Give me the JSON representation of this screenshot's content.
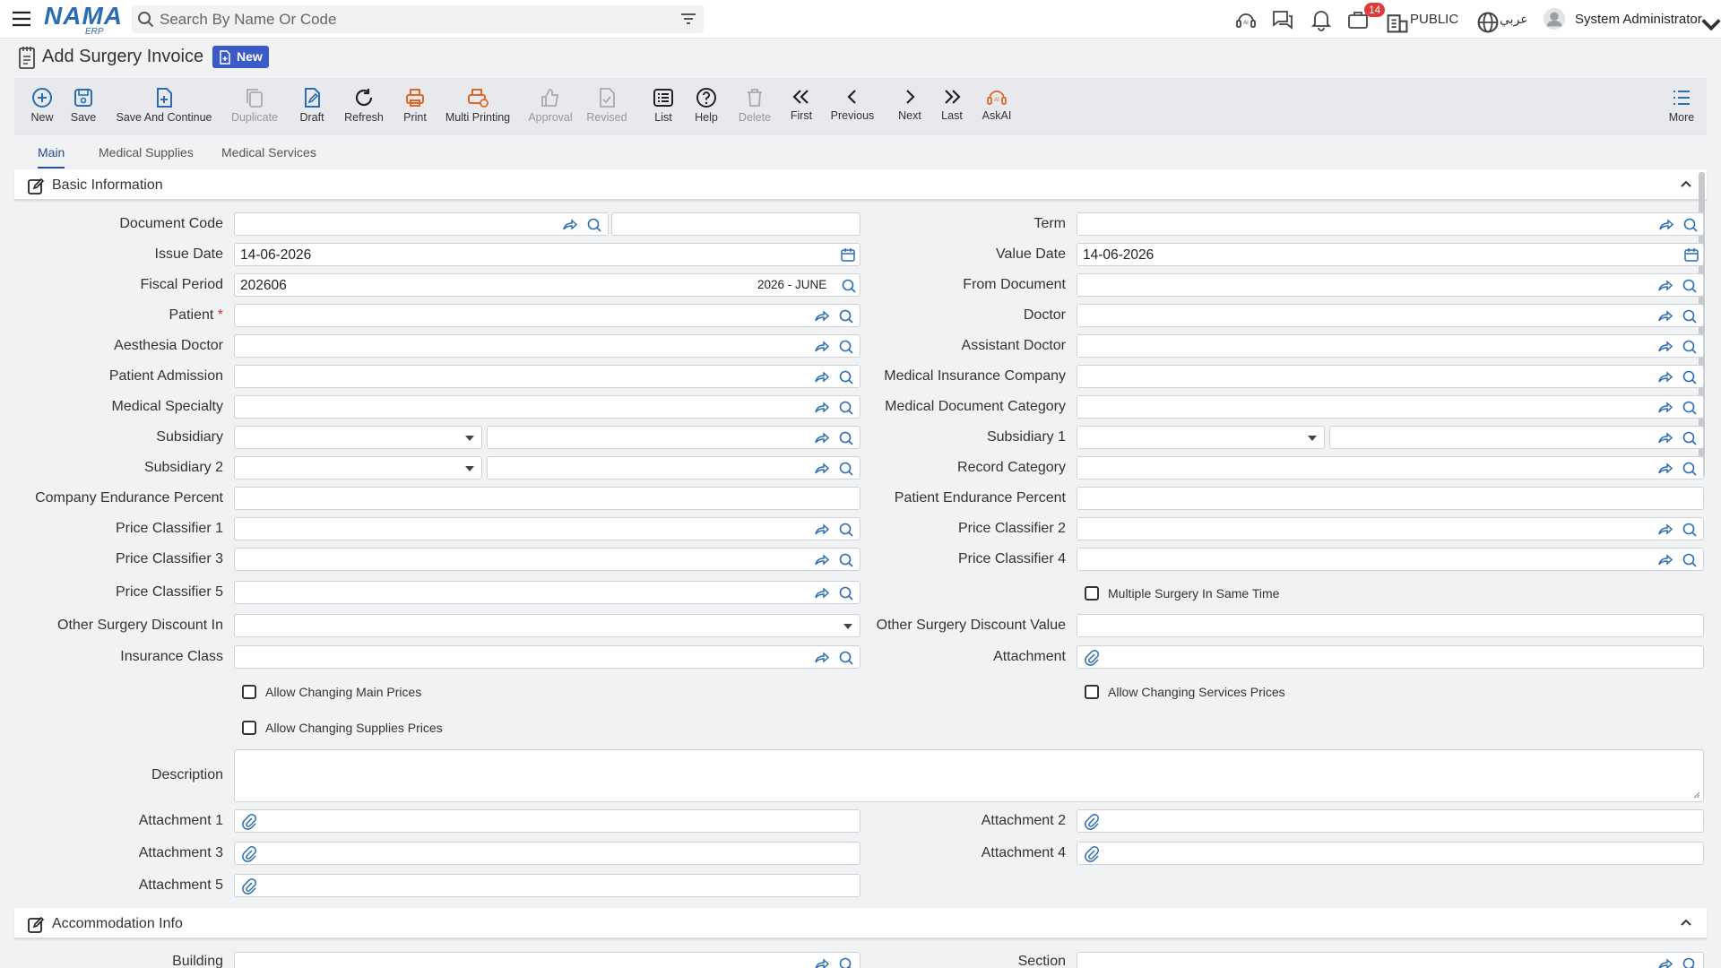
{
  "topbar": {
    "logo": "NAMA",
    "logo_sub": "ERP",
    "search_placeholder": "Search By Name Or Code",
    "notification_count": "14",
    "public_label": "PUBLIC",
    "language_label": "عربي",
    "user_name": "System Administrator"
  },
  "page": {
    "title": "Add Surgery Invoice",
    "status_badge": "New"
  },
  "toolbar": {
    "new": "New",
    "save": "Save",
    "save_continue": "Save And Continue",
    "duplicate": "Duplicate",
    "draft": "Draft",
    "refresh": "Refresh",
    "print": "Print",
    "multi_printing": "Multi Printing",
    "approval": "Approval",
    "revised": "Revised",
    "list": "List",
    "help": "Help",
    "delete": "Delete",
    "first": "First",
    "previous": "Previous",
    "next": "Next",
    "last": "Last",
    "askai": "AskAI",
    "more": "More"
  },
  "tabs": [
    "Main",
    "Medical Supplies",
    "Medical Services"
  ],
  "sections": {
    "basic": "Basic Information",
    "accommodation": "Accommodation Info"
  },
  "labels": {
    "document_code": "Document Code",
    "term": "Term",
    "issue_date": "Issue Date",
    "value_date": "Value Date",
    "fiscal_period": "Fiscal Period",
    "from_document": "From Document",
    "patient": "Patient",
    "doctor": "Doctor",
    "aesthesia_doctor": "Aesthesia Doctor",
    "assistant_doctor": "Assistant Doctor",
    "patient_admission": "Patient Admission",
    "medical_insurance_company": "Medical Insurance Company",
    "medical_specialty": "Medical Specialty",
    "medical_document_category": "Medical Document Category",
    "subsidiary": "Subsidiary",
    "subsidiary_1": "Subsidiary 1",
    "subsidiary_2": "Subsidiary 2",
    "record_category": "Record Category",
    "company_endurance_percent": "Company Endurance Percent",
    "patient_endurance_percent": "Patient Endurance Percent",
    "price_classifier_1": "Price Classifier 1",
    "price_classifier_2": "Price Classifier 2",
    "price_classifier_3": "Price Classifier 3",
    "price_classifier_4": "Price Classifier 4",
    "price_classifier_5": "Price Classifier 5",
    "multiple_surgery": "Multiple Surgery In Same Time",
    "other_surgery_discount_in": "Other Surgery Discount In",
    "other_surgery_discount_value": "Other Surgery Discount Value",
    "insurance_class": "Insurance Class",
    "attachment": "Attachment",
    "allow_main_prices": "Allow Changing Main Prices",
    "allow_services_prices": "Allow Changing Services Prices",
    "allow_supplies_prices": "Allow Changing Supplies Prices",
    "description": "Description",
    "attachment_1": "Attachment 1",
    "attachment_2": "Attachment 2",
    "attachment_3": "Attachment 3",
    "attachment_4": "Attachment 4",
    "attachment_5": "Attachment 5",
    "building": "Building",
    "section": "Section"
  },
  "values": {
    "issue_date": "14-06-2026",
    "value_date": "14-06-2026",
    "fiscal_period_code": "202606",
    "fiscal_period_name": "2026 - JUNE"
  },
  "colors": {
    "accent": "#2a4d9b",
    "badge": "#3a5bc7",
    "icon_blue": "#2a6db4",
    "icon_orange": "#e0672a"
  }
}
